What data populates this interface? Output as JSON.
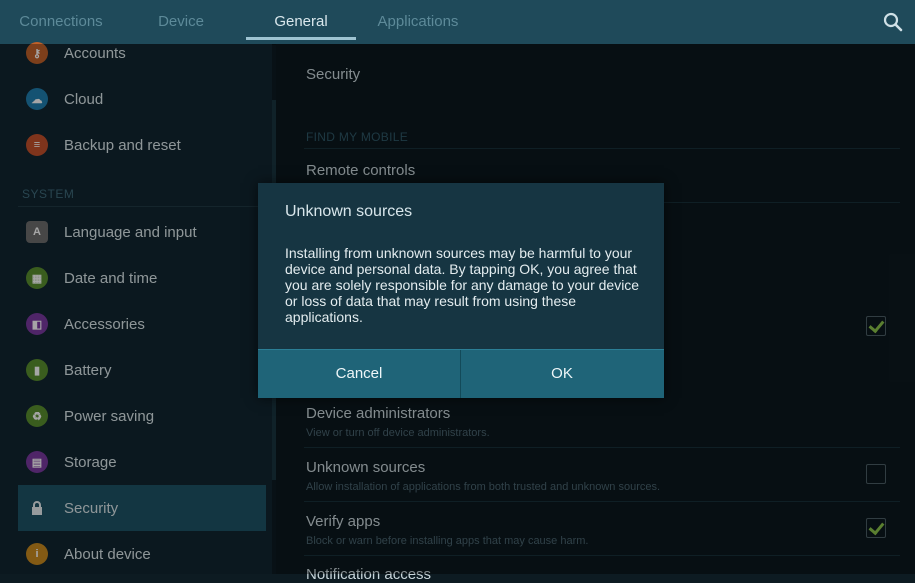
{
  "tabs": [
    {
      "label": "Connections"
    },
    {
      "label": "Device"
    },
    {
      "label": "General"
    },
    {
      "label": "Applications"
    }
  ],
  "active_tab": "General",
  "search_icon": "search-icon",
  "left": {
    "items_top": [
      {
        "label": "Accounts",
        "icon": "key-icon",
        "color": "#c0612a"
      },
      {
        "label": "Cloud",
        "icon": "cloud-icon",
        "color": "#1f7fb0"
      },
      {
        "label": "Backup and reset",
        "icon": "backup-icon",
        "color": "#c4502b"
      }
    ],
    "system_header": "SYSTEM",
    "items_system": [
      {
        "label": "Language and input",
        "icon": "keyboard-icon",
        "color": "#6d6d6d"
      },
      {
        "label": "Date and time",
        "icon": "calendar-icon",
        "color": "#5a8f2f"
      },
      {
        "label": "Accessories",
        "icon": "accessories-icon",
        "color": "#7a3aa0"
      },
      {
        "label": "Battery",
        "icon": "battery-icon",
        "color": "#5a8f2f"
      },
      {
        "label": "Power saving",
        "icon": "power-saving-icon",
        "color": "#5a8f2f"
      },
      {
        "label": "Storage",
        "icon": "storage-icon",
        "color": "#7a3aa0"
      },
      {
        "label": "Security",
        "icon": "lock-icon",
        "color": "#1e5466"
      },
      {
        "label": "About device",
        "icon": "info-icon",
        "color": "#c98a1f"
      }
    ]
  },
  "right": {
    "security_label": "Security",
    "find_my_mobile": "FIND MY MOBILE",
    "remote_controls": "Remote controls",
    "device_admins": {
      "title": "Device administrators",
      "sub": "View or turn off device administrators."
    },
    "unknown_sources": {
      "title": "Unknown sources",
      "sub": "Allow installation of applications from both trusted and unknown sources."
    },
    "verify_apps": {
      "title": "Verify apps",
      "sub": "Block or warn before installing apps that may cause harm."
    },
    "notification_access": "Notification access"
  },
  "dialog": {
    "title": "Unknown sources",
    "body": "Installing from unknown sources may be harmful to your device and personal data. By tapping OK, you agree that you are solely responsible for any damage to your device or loss of data that may result from using these applications.",
    "cancel": "Cancel",
    "ok": "OK"
  },
  "colors": {
    "accent": "#1f6478",
    "check": "#8bc34a"
  }
}
